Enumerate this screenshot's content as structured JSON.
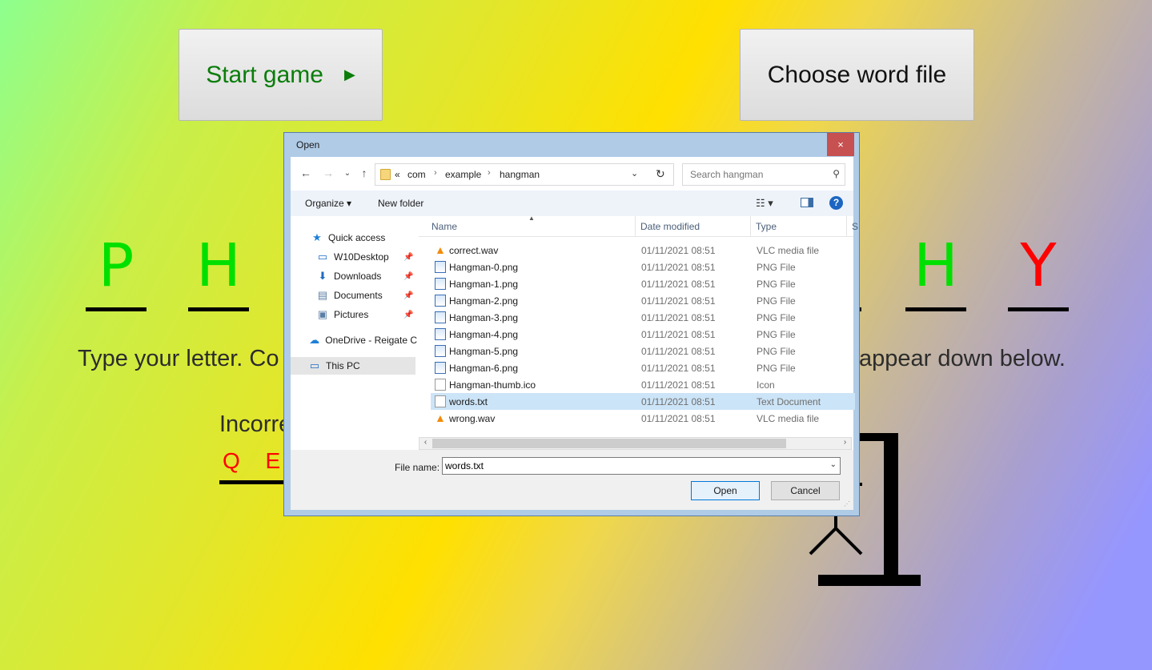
{
  "buttons": {
    "start": "Start game",
    "start_icon": "play-icon",
    "choose_file": "Choose word file"
  },
  "word": [
    {
      "char": "P",
      "color": "#00e000"
    },
    {
      "char": "H",
      "color": "#00e000"
    },
    {
      "char": "H",
      "color": "#00e000"
    },
    {
      "char": "Y",
      "color": "#ff0000"
    }
  ],
  "instruction": {
    "left": "Type your letter. Co",
    "right": "appear down below."
  },
  "incorrect": {
    "label": "Incorre",
    "letters": "Q E R"
  },
  "dialog": {
    "title": "Open",
    "close": "×",
    "address": {
      "overflow": "«",
      "crumbs": [
        "com",
        "example",
        "hangman"
      ]
    },
    "search_placeholder": "Search hangman",
    "commands": {
      "organize": "Organize ▾",
      "new_folder": "New folder"
    },
    "nav": {
      "quick_access": "Quick access",
      "items": [
        "W10Desktop",
        "Downloads",
        "Documents",
        "Pictures"
      ],
      "onedrive": "OneDrive - Reigate C",
      "this_pc": "This PC"
    },
    "columns": [
      "Name",
      "Date modified",
      "Type",
      "S"
    ],
    "files": [
      {
        "name": "correct.wav",
        "date": "01/11/2021 08:51",
        "type": "VLC media file",
        "icon": "vlc-icon"
      },
      {
        "name": "Hangman-0.png",
        "date": "01/11/2021 08:51",
        "type": "PNG File",
        "icon": "png-file-icon"
      },
      {
        "name": "Hangman-1.png",
        "date": "01/11/2021 08:51",
        "type": "PNG File",
        "icon": "png-file-icon"
      },
      {
        "name": "Hangman-2.png",
        "date": "01/11/2021 08:51",
        "type": "PNG File",
        "icon": "png-file-icon"
      },
      {
        "name": "Hangman-3.png",
        "date": "01/11/2021 08:51",
        "type": "PNG File",
        "icon": "png-file-icon"
      },
      {
        "name": "Hangman-4.png",
        "date": "01/11/2021 08:51",
        "type": "PNG File",
        "icon": "png-file-icon"
      },
      {
        "name": "Hangman-5.png",
        "date": "01/11/2021 08:51",
        "type": "PNG File",
        "icon": "png-file-icon"
      },
      {
        "name": "Hangman-6.png",
        "date": "01/11/2021 08:51",
        "type": "PNG File",
        "icon": "png-file-icon"
      },
      {
        "name": "Hangman-thumb.ico",
        "date": "01/11/2021 08:51",
        "type": "Icon",
        "icon": "ico-file-icon"
      },
      {
        "name": "words.txt",
        "date": "01/11/2021 08:51",
        "type": "Text Document",
        "icon": "text-file-icon",
        "selected": true
      },
      {
        "name": "wrong.wav",
        "date": "01/11/2021 08:51",
        "type": "VLC media file",
        "icon": "vlc-icon"
      }
    ],
    "file_name_label": "File name:",
    "file_name_value": "words.txt",
    "open": "Open",
    "cancel": "Cancel"
  }
}
